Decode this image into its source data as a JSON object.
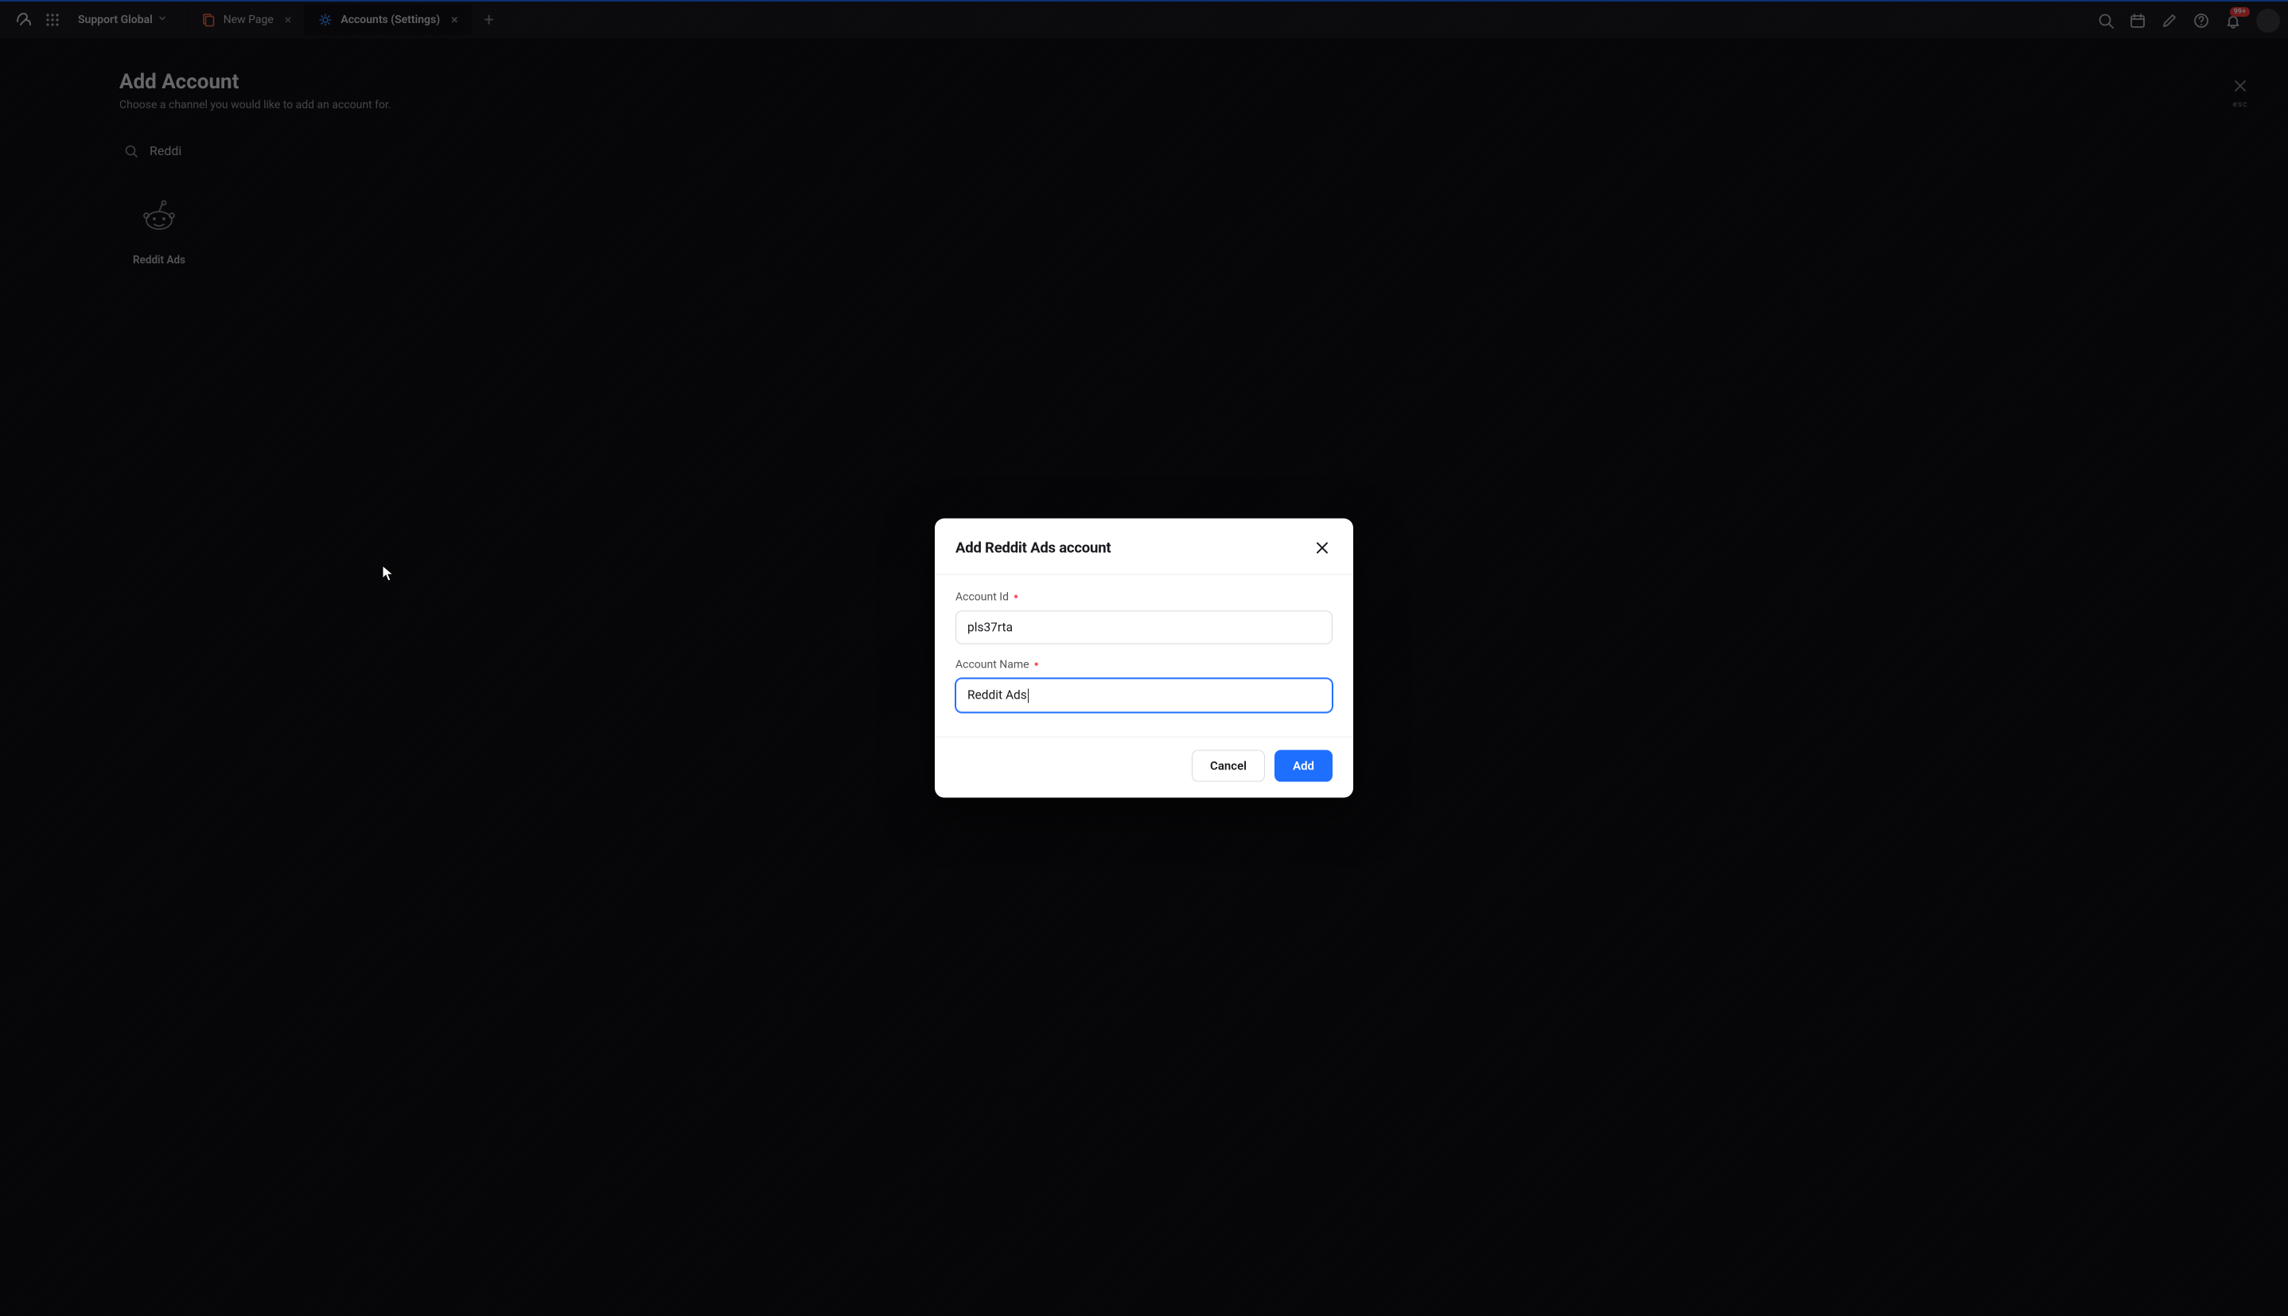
{
  "topbar": {
    "workspace": "Support Global",
    "tabs": [
      {
        "label": "New Page",
        "active": false
      },
      {
        "label": "Accounts (Settings)",
        "active": true
      }
    ],
    "notification_badge": "99+"
  },
  "background_page": {
    "title": "Add Account",
    "subtitle": "Choose a channel you would like to add an account for.",
    "esc_label": "esc",
    "search_value": "Reddi",
    "channel_card": {
      "label": "Reddit Ads"
    }
  },
  "modal": {
    "title": "Add Reddit Ads account",
    "fields": {
      "account_id": {
        "label": "Account Id",
        "value": "pls37rta"
      },
      "account_name": {
        "label": "Account Name",
        "value": "Reddit Ads"
      }
    },
    "buttons": {
      "cancel": "Cancel",
      "add": "Add"
    }
  }
}
